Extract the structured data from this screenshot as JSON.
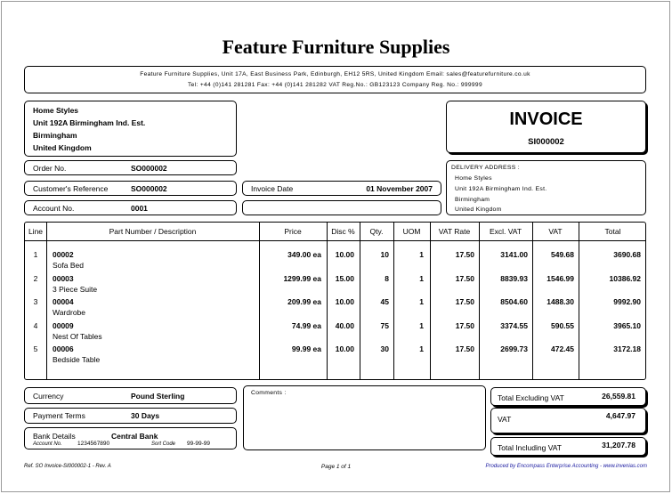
{
  "company": {
    "name": "Feature Furniture Supplies",
    "address_line": "Feature Furniture Supplies, Unit 17A, East Business Park, Edinburgh, EH12 5RS, United Kingdom   Email: sales@featurefurniture.co.uk",
    "contact_line": "Tel: +44 (0)141 281281   Fax: +44 (0)141 281282   VAT Reg.No.: GB123123   Company Reg. No.: 999999"
  },
  "customer": {
    "lines": [
      "Home Styles",
      "Unit 192A Birmingham Ind. Est.",
      "Birmingham",
      "United Kingdom"
    ]
  },
  "document": {
    "type": "INVOICE",
    "number": "SI000002"
  },
  "order": {
    "order_no_label": "Order No.",
    "order_no": "SO000002",
    "cust_ref_label": "Customer's Reference",
    "cust_ref": "SO000002",
    "account_label": "Account No.",
    "account": "0001",
    "invoice_date_label": "Invoice Date",
    "invoice_date": "01 November 2007"
  },
  "delivery": {
    "label": "DELIVERY ADDRESS :",
    "lines": [
      "Home Styles",
      "Unit 192A Birmingham Ind. Est.",
      "Birmingham",
      "United Kingdom"
    ]
  },
  "table": {
    "headers": {
      "line": "Line",
      "part": "Part Number / Description",
      "price": "Price",
      "disc": "Disc %",
      "qty": "Qty.",
      "uom": "UOM",
      "vat_rate": "VAT Rate",
      "excl_vat": "Excl. VAT",
      "vat": "VAT",
      "total": "Total"
    },
    "rows": [
      {
        "line": "1",
        "part": "00002",
        "desc": "Sofa Bed",
        "price": "349.00 ea",
        "disc": "10.00",
        "qty": "10",
        "uom": "1",
        "vat_rate": "17.50",
        "excl": "3141.00",
        "vat": "549.68",
        "total": "3690.68"
      },
      {
        "line": "2",
        "part": "00003",
        "desc": "3 Piece Suite",
        "price": "1299.99 ea",
        "disc": "15.00",
        "qty": "8",
        "uom": "1",
        "vat_rate": "17.50",
        "excl": "8839.93",
        "vat": "1546.99",
        "total": "10386.92"
      },
      {
        "line": "3",
        "part": "00004",
        "desc": "Wardrobe",
        "price": "209.99 ea",
        "disc": "10.00",
        "qty": "45",
        "uom": "1",
        "vat_rate": "17.50",
        "excl": "8504.60",
        "vat": "1488.30",
        "total": "9992.90"
      },
      {
        "line": "4",
        "part": "00009",
        "desc": "Nest Of Tables",
        "price": "74.99 ea",
        "disc": "40.00",
        "qty": "75",
        "uom": "1",
        "vat_rate": "17.50",
        "excl": "3374.55",
        "vat": "590.55",
        "total": "3965.10"
      },
      {
        "line": "5",
        "part": "00006",
        "desc": "Bedside Table",
        "price": "99.99 ea",
        "disc": "10.00",
        "qty": "30",
        "uom": "1",
        "vat_rate": "17.50",
        "excl": "2699.73",
        "vat": "472.45",
        "total": "3172.18"
      }
    ]
  },
  "payment": {
    "currency_label": "Currency",
    "currency": "Pound Sterling",
    "terms_label": "Payment Terms",
    "terms": "30 Days",
    "bank_label": "Bank Details",
    "bank": "Central Bank",
    "account_no_label": "Account No.",
    "account_no": "1234567890",
    "sort_code_label": "Sort Code",
    "sort_code": "99-99-99"
  },
  "comments": {
    "label": "Comments :"
  },
  "totals": {
    "excl_label": "Total Excluding VAT",
    "excl": "26,559.81",
    "vat_label": "VAT",
    "vat": "4,647.97",
    "incl_label": "Total Including VAT",
    "incl": "31,207.78"
  },
  "footer": {
    "ref": "Ref. SO Invoice-SI000002-1 - Rev. A",
    "page": "Page 1 of 1",
    "produced_by": "Produced by Encompass Enterprise Accounting - www.invenias.com"
  },
  "colors": {
    "footer_link": "#1a1aa0",
    "border": "#000000"
  }
}
